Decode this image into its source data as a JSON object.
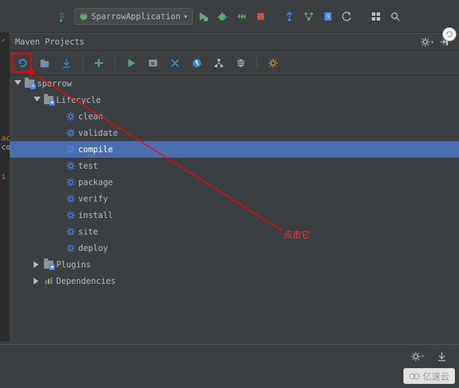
{
  "top": {
    "switch_bits": "01\n10\n01",
    "run_config_label": "SparrowApplication"
  },
  "panel": {
    "title": "Maven Projects"
  },
  "tree": {
    "root": "sparrow",
    "lifecycle_label": "Lifecycle",
    "lifecycle": [
      "clean",
      "validate",
      "compile",
      "test",
      "package",
      "verify",
      "install",
      "site",
      "deploy"
    ],
    "selected_index": 2,
    "plugins_label": "Plugins",
    "dependencies_label": "Dependencies"
  },
  "annotation": {
    "text": "点击它"
  },
  "watermark": "亿速云",
  "colors": {
    "bg": "#3c3f41",
    "selection": "#4b6eaf",
    "text": "#bbbbbb",
    "accent_green": "#59a869",
    "accent_red": "#ff0000",
    "gear_blue": "#4a8af4"
  }
}
